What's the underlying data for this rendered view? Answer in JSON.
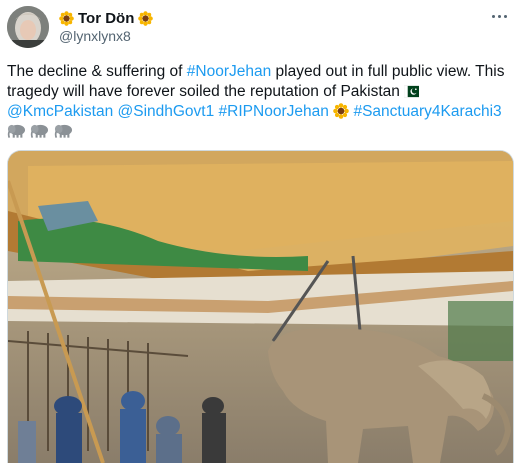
{
  "tweet": {
    "author": {
      "display_name": "Tor Dön",
      "handle": "@lynxlynx8",
      "avatar": "avatar-photo",
      "name_decoration_icon": "sunflower-icon"
    },
    "more_icon": "more-horizontal-icon",
    "lines": [
      [
        {
          "text": "The decline & suffering of ",
          "kind": "text"
        },
        {
          "text": "#NoorJehan",
          "kind": "tag"
        },
        {
          "text": " played out in full public view. This",
          "kind": "text"
        }
      ],
      [
        {
          "text": "tragedy will have forever soiled the reputation of Pakistan ",
          "kind": "text"
        }
      ],
      [
        {
          "text": "@KmcPakistan",
          "kind": "tag"
        },
        {
          "text": " ",
          "kind": "text"
        },
        {
          "text": "@SindhGovt1",
          "kind": "tag"
        },
        {
          "text": " ",
          "kind": "text"
        },
        {
          "text": "#RIPNoorJehan",
          "kind": "tag"
        },
        {
          "text": " ",
          "kind": "text"
        },
        {
          "text": " ",
          "kind": "text"
        },
        {
          "text": "#Sanctuary4Karachi3",
          "kind": "tag"
        }
      ]
    ],
    "inline_icons": {
      "flag": "pakistan-flag-icon",
      "sunflower": "sunflower-icon",
      "elephants": [
        "elephant-icon",
        "elephant-icon",
        "elephant-icon"
      ]
    },
    "media": {
      "type": "video-still",
      "description_icon": "elephant-video-thumbnail"
    },
    "colors": {
      "link": "#1d9bf0",
      "text": "#0f1419",
      "secondary": "#536471"
    }
  }
}
